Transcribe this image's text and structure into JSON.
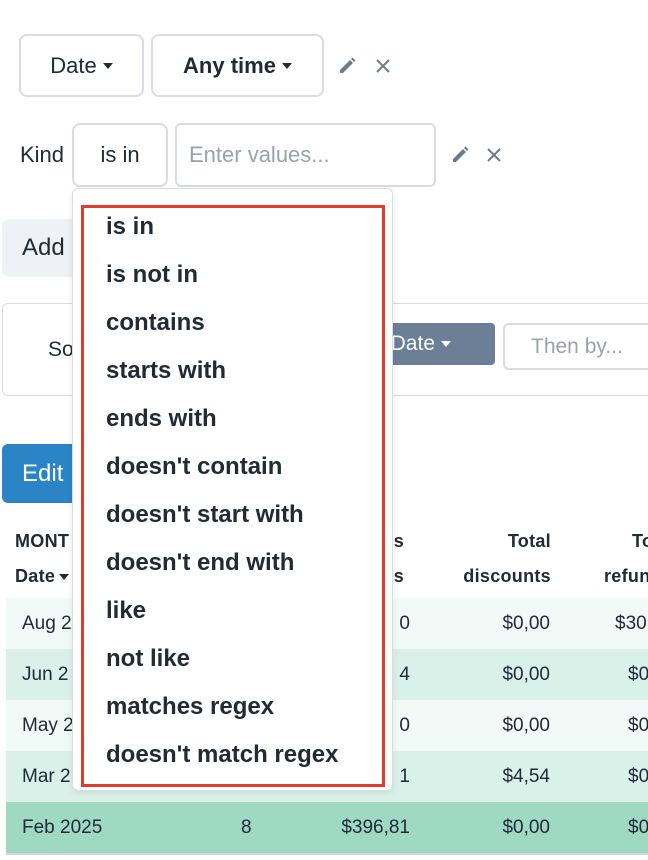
{
  "filters": {
    "row1": {
      "field_label": "Date",
      "range_label": "Any time"
    },
    "row2": {
      "field_label": "Kind",
      "operator_label": "is in",
      "values_placeholder": "Enter values..."
    }
  },
  "add_button_label": "Add",
  "sort": {
    "label": "So",
    "field_label": "Date",
    "then_by_placeholder": "Then by..."
  },
  "edit_button_label": "Edit",
  "table": {
    "header": {
      "month_line1": "MONT",
      "month_line2": "Date",
      "col3_line1": "s",
      "col3_line2": "s",
      "total_discounts_line1": "Total",
      "total_discounts_line2": "discounts",
      "total_refunds_line1": "To",
      "total_refunds_line2": "refun"
    },
    "rows": [
      {
        "month": "Aug 2",
        "orders": "",
        "sales": "0",
        "discounts": "$0,00",
        "refunds": "$30"
      },
      {
        "month": "Jun 2",
        "orders": "",
        "sales": "4",
        "discounts": "$0,00",
        "refunds": "$0"
      },
      {
        "month": "May 2",
        "orders": "",
        "sales": "0",
        "discounts": "$0,00",
        "refunds": "$0"
      },
      {
        "month": "Mar 2",
        "orders": "",
        "sales": "1",
        "discounts": "$4,54",
        "refunds": "$0"
      },
      {
        "month": "Feb 2025",
        "orders": "8",
        "sales": "$396,81",
        "discounts": "$0,00",
        "refunds": "$0"
      }
    ]
  },
  "dropdown": {
    "options": [
      "is in",
      "is not in",
      "contains",
      "starts with",
      "ends with",
      "doesn't contain",
      "doesn't start with",
      "doesn't end with",
      "like",
      "not like",
      "matches regex",
      "doesn't match regex"
    ]
  },
  "colors": {
    "primary_button": "#2a84c6",
    "sort_chip": "#6b7f97",
    "highlight_border": "#e23a2c",
    "row_light": "#f1faf7",
    "row_medium": "#d9f1e9",
    "row_dark": "#9fd8c3"
  },
  "icons": [
    "pencil-icon",
    "close-icon",
    "caret-down-icon"
  ]
}
